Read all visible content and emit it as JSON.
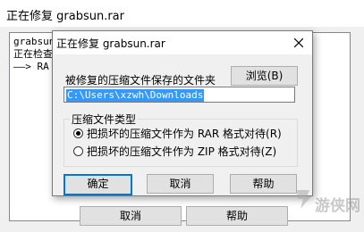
{
  "background_window": {
    "title": "正在修复 grabsun.rar",
    "log_lines": [
      "grabsun",
      "正在检查",
      "——> RA"
    ],
    "cancel_label": "取消",
    "help_label": "帮助"
  },
  "dialog": {
    "title": "正在修复 grabsun.rar",
    "path_label": "被修复的压缩文件保存的文件夹",
    "browse_label": "浏览(B)",
    "path_value": "C:\\Users\\xzwh\\Downloads",
    "archive_type_group": {
      "title": "压缩文件类型",
      "options": [
        {
          "label": "把损坏的压缩文件作为 RAR 格式对待(R)",
          "checked": true
        },
        {
          "label": "把损坏的压缩文件作为 ZIP 格式对待(Z)",
          "checked": false
        }
      ]
    },
    "ok_label": "确定",
    "cancel_label": "取消",
    "help_label": "帮助"
  },
  "watermark": {
    "text": "游侠网"
  },
  "colors": {
    "selection": "#3399ff",
    "default_button_border": "#0078d7"
  }
}
